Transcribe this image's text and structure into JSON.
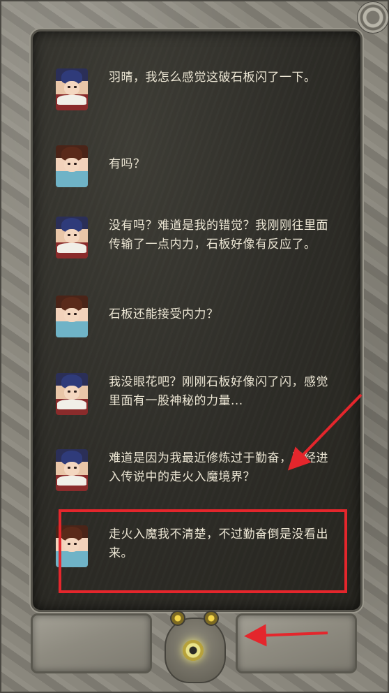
{
  "messages": [
    {
      "speaker": "male",
      "text": "羽晴，我怎么感觉这破石板闪了一下。"
    },
    {
      "speaker": "female",
      "text": "有吗？"
    },
    {
      "speaker": "male",
      "text": "没有吗？难道是我的错觉？我刚刚往里面传输了一点内力，石板好像有反应了。"
    },
    {
      "speaker": "female",
      "text": "石板还能接受内力？"
    },
    {
      "speaker": "male",
      "text": "我没眼花吧？刚刚石板好像闪了闪，感觉里面有一股神秘的力量..."
    },
    {
      "speaker": "male",
      "text": "难道是因为我最近修炼过于勤奋，已经进入传说中的走火入魔境界？"
    },
    {
      "speaker": "female",
      "text": "走火入魔我不清楚，不过勤奋倒是没看出来。"
    }
  ],
  "colors": {
    "annotation_red": "#e4262c",
    "text": "#ece6d4",
    "board": "#2d2c27"
  },
  "icons": {
    "settings": "gear-icon",
    "toad": "golden-toad-icon"
  }
}
